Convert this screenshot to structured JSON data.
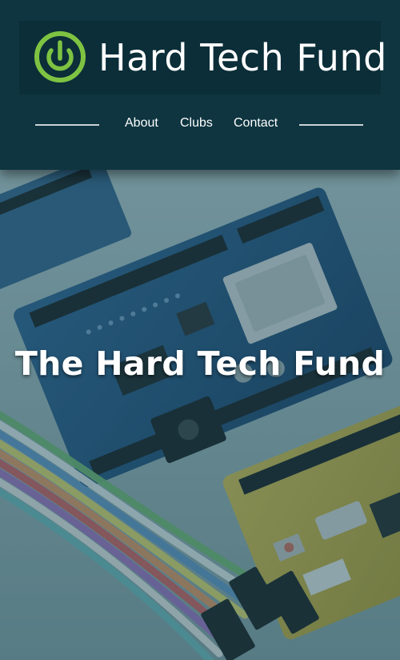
{
  "brand": {
    "logo_icon": "power-button-icon",
    "name": "Hard Tech Fund",
    "accent_color": "#7ec342"
  },
  "nav": {
    "items": [
      {
        "label": "About"
      },
      {
        "label": "Clubs"
      },
      {
        "label": "Contact"
      }
    ]
  },
  "hero": {
    "title": "The Hard Tech Fund",
    "image": "electronics-boards-and-jumper-wires"
  },
  "colors": {
    "header_bg": "#0e3540",
    "brand_bg": "#0b2e38",
    "hero_overlay": "#184e5c"
  }
}
